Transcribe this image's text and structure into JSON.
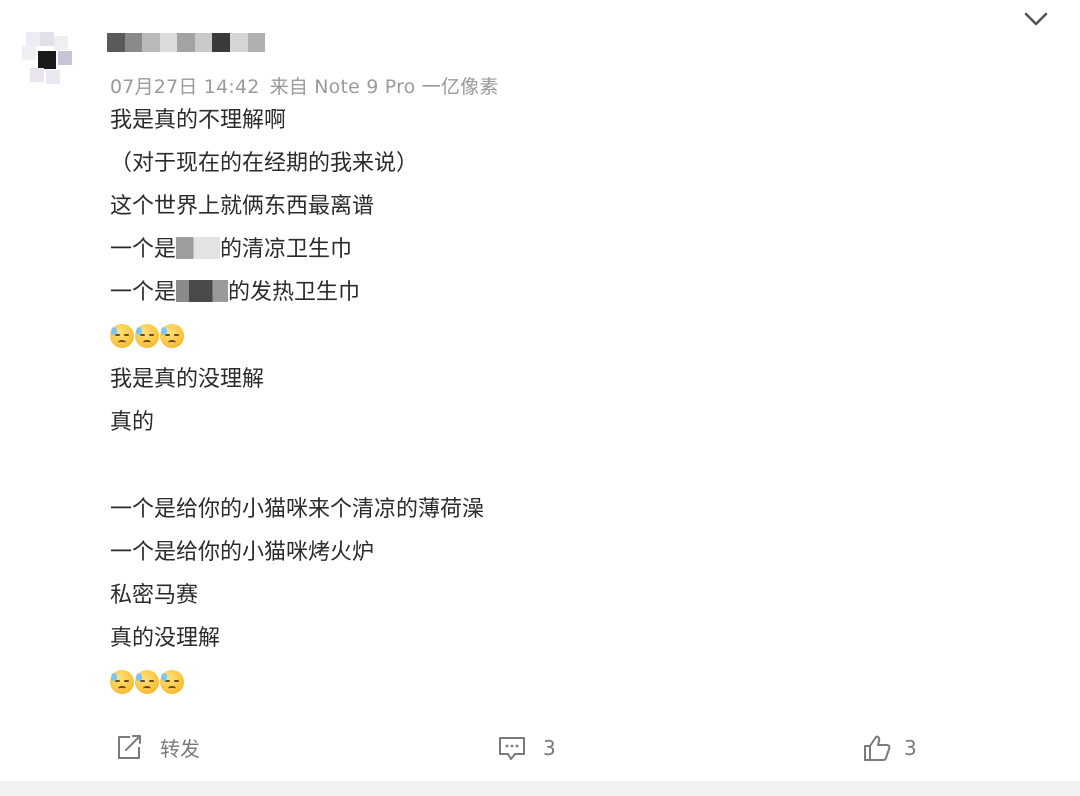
{
  "post": {
    "meta": {
      "time": "07月27日 14:42",
      "source": "来自 Note 9 Pro 一亿像素"
    },
    "lines": [
      "我是真的不理解啊",
      "（对于现在的在经期的我来说）",
      "这个世界上就俩东西最离谱"
    ],
    "line4": {
      "prefix": "一个是",
      "suffix": "的清凉卫生巾"
    },
    "line5": {
      "prefix": "一个是",
      "suffix": "的发热卫生巾"
    },
    "lines_b": [
      "我是真的没理解",
      "真的"
    ],
    "lines_c": [
      "一个是给你的小猫咪来个清凉的薄荷澡",
      "一个是给你的小猫咪烤火炉",
      "私密马赛",
      "真的没理解"
    ],
    "emoji_icon": "sweat-smile-emoji"
  },
  "actions": {
    "repost_label": "转发",
    "comment_count": "3",
    "like_count": "3"
  },
  "colors": {
    "text": "#2b2b2b",
    "meta": "#9a9a9a",
    "action": "#7a7a7a",
    "band": "#f2f2f2"
  }
}
